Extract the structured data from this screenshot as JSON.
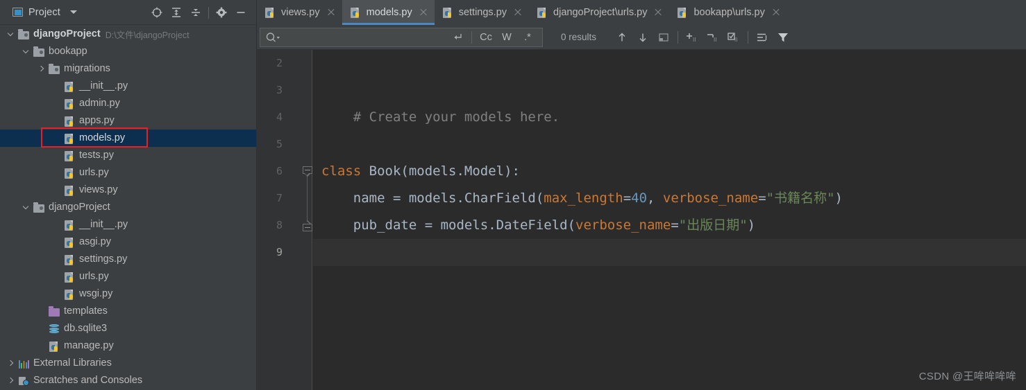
{
  "sidebar": {
    "panel_title": "Project",
    "panel_icon": "project-window-icon",
    "tools": [
      {
        "name": "locate-in-tree-icon",
        "label": "Select Opened File"
      },
      {
        "name": "expand-all-icon",
        "label": "Expand All"
      },
      {
        "name": "collapse-all-icon",
        "label": "Collapse All"
      },
      {
        "name": "settings-gear-icon",
        "label": "Settings"
      },
      {
        "name": "hide-panel-icon",
        "label": "Hide"
      }
    ],
    "tree": [
      {
        "label": "djangoProject",
        "path": "D:\\文件\\djangoProject",
        "icon": "folder-icon",
        "indent": 0,
        "arrow": "down",
        "bold": true,
        "selected": false
      },
      {
        "label": "bookapp",
        "path": "",
        "icon": "folder-icon",
        "indent": 1,
        "arrow": "down",
        "bold": false,
        "selected": false
      },
      {
        "label": "migrations",
        "path": "",
        "icon": "folder-icon",
        "indent": 2,
        "arrow": "right",
        "bold": false,
        "selected": false
      },
      {
        "label": "__init__.py",
        "path": "",
        "icon": "python-file-icon",
        "indent": 3,
        "arrow": "none",
        "bold": false,
        "selected": false
      },
      {
        "label": "admin.py",
        "path": "",
        "icon": "python-file-icon",
        "indent": 3,
        "arrow": "none",
        "bold": false,
        "selected": false
      },
      {
        "label": "apps.py",
        "path": "",
        "icon": "python-file-icon",
        "indent": 3,
        "arrow": "none",
        "bold": false,
        "selected": false
      },
      {
        "label": "models.py",
        "path": "",
        "icon": "python-file-icon",
        "indent": 3,
        "arrow": "none",
        "bold": false,
        "selected": true
      },
      {
        "label": "tests.py",
        "path": "",
        "icon": "python-file-icon",
        "indent": 3,
        "arrow": "none",
        "bold": false,
        "selected": false
      },
      {
        "label": "urls.py",
        "path": "",
        "icon": "python-file-icon",
        "indent": 3,
        "arrow": "none",
        "bold": false,
        "selected": false
      },
      {
        "label": "views.py",
        "path": "",
        "icon": "python-file-icon",
        "indent": 3,
        "arrow": "none",
        "bold": false,
        "selected": false
      },
      {
        "label": "djangoProject",
        "path": "",
        "icon": "folder-icon",
        "indent": 1,
        "arrow": "down",
        "bold": false,
        "selected": false
      },
      {
        "label": "__init__.py",
        "path": "",
        "icon": "python-file-icon",
        "indent": 3,
        "arrow": "none",
        "bold": false,
        "selected": false
      },
      {
        "label": "asgi.py",
        "path": "",
        "icon": "python-file-icon",
        "indent": 3,
        "arrow": "none",
        "bold": false,
        "selected": false
      },
      {
        "label": "settings.py",
        "path": "",
        "icon": "python-file-icon",
        "indent": 3,
        "arrow": "none",
        "bold": false,
        "selected": false
      },
      {
        "label": "urls.py",
        "path": "",
        "icon": "python-file-icon",
        "indent": 3,
        "arrow": "none",
        "bold": false,
        "selected": false
      },
      {
        "label": "wsgi.py",
        "path": "",
        "icon": "python-file-icon",
        "indent": 3,
        "arrow": "none",
        "bold": false,
        "selected": false
      },
      {
        "label": "templates",
        "path": "",
        "icon": "folder-purple-icon",
        "indent": 2,
        "arrow": "none",
        "bold": false,
        "selected": false
      },
      {
        "label": "db.sqlite3",
        "path": "",
        "icon": "database-icon",
        "indent": 2,
        "arrow": "none",
        "bold": false,
        "selected": false
      },
      {
        "label": "manage.py",
        "path": "",
        "icon": "python-file-icon",
        "indent": 2,
        "arrow": "none",
        "bold": false,
        "selected": false
      },
      {
        "label": "External Libraries",
        "path": "",
        "icon": "external-libraries-icon",
        "indent": 0,
        "arrow": "right",
        "bold": false,
        "selected": false
      },
      {
        "label": "Scratches and Consoles",
        "path": "",
        "icon": "scratches-icon",
        "indent": 0,
        "arrow": "right",
        "bold": false,
        "selected": false
      }
    ]
  },
  "tabs": [
    {
      "label": "views.py",
      "active": false
    },
    {
      "label": "models.py",
      "active": true
    },
    {
      "label": "settings.py",
      "active": false
    },
    {
      "label": "djangoProject\\urls.py",
      "active": false
    },
    {
      "label": "bookapp\\urls.py",
      "active": false
    }
  ],
  "findbar": {
    "query": "",
    "placeholder": "",
    "search_icon": "search-icon",
    "options": [
      {
        "name": "regex-newline-icon",
        "label": ""
      },
      {
        "name": "match-case-option",
        "label": "Cc"
      },
      {
        "name": "words-option",
        "label": "W"
      },
      {
        "name": "regex-option",
        "label": ".*"
      }
    ],
    "results_text": "0 results",
    "buttons": [
      {
        "name": "find-previous-icon",
        "label": "Previous Occurrence"
      },
      {
        "name": "find-next-icon",
        "label": "Next Occurrence"
      },
      {
        "name": "select-all-occurrences-icon",
        "label": "Select All Occurrences"
      },
      {
        "name": "add-selection-next-icon",
        "label": "Add Selection for Next Occurrence"
      },
      {
        "name": "unselect-occurrence-icon",
        "label": "Unselect Occurrence"
      },
      {
        "name": "select-all-icon",
        "label": "Select All"
      },
      {
        "name": "find-in-selection-icon",
        "label": "In Selection"
      },
      {
        "name": "filter-icon",
        "label": "Filter"
      }
    ]
  },
  "editor": {
    "file": "models.py",
    "current_line": 9,
    "lines": [
      {
        "num": 2,
        "tokens": []
      },
      {
        "num": 3,
        "tokens": []
      },
      {
        "num": 4,
        "tokens": [
          {
            "t": "    # Create your models here.",
            "c": "c-comment"
          }
        ]
      },
      {
        "num": 5,
        "tokens": []
      },
      {
        "num": 6,
        "tokens": [
          {
            "t": "class ",
            "c": "c-kw"
          },
          {
            "t": "Book(models.Model):",
            "c": "c-cls"
          }
        ]
      },
      {
        "num": 7,
        "tokens": [
          {
            "t": "    name = models.CharField(",
            "c": "c-fn"
          },
          {
            "t": "max_length",
            "c": "c-param"
          },
          {
            "t": "=",
            "c": "c-fn"
          },
          {
            "t": "40",
            "c": "c-num"
          },
          {
            "t": ", ",
            "c": "c-fn"
          },
          {
            "t": "verbose_name",
            "c": "c-param"
          },
          {
            "t": "=",
            "c": "c-fn"
          },
          {
            "t": "\"书籍名称\"",
            "c": "c-str"
          },
          {
            "t": ")",
            "c": "c-fn"
          }
        ]
      },
      {
        "num": 8,
        "tokens": [
          {
            "t": "    pub_date = models.DateField(",
            "c": "c-fn"
          },
          {
            "t": "verbose_name",
            "c": "c-param"
          },
          {
            "t": "=",
            "c": "c-fn"
          },
          {
            "t": "\"出版日期\"",
            "c": "c-str"
          },
          {
            "t": ")",
            "c": "c-fn"
          }
        ]
      },
      {
        "num": 9,
        "tokens": []
      }
    ]
  },
  "watermark": "CSDN @王哞哞哞哞",
  "colors": {
    "selection_blue": "#0d2f4f",
    "annotation_red": "#ee1c25",
    "active_tab_underline": "#4a88c7",
    "keyword_orange": "#cc7832",
    "string_green": "#6a8759",
    "number_blue": "#6897bb",
    "comment_gray": "#808080",
    "editor_bg": "#2b2b2b",
    "panel_bg": "#3c3f41"
  }
}
